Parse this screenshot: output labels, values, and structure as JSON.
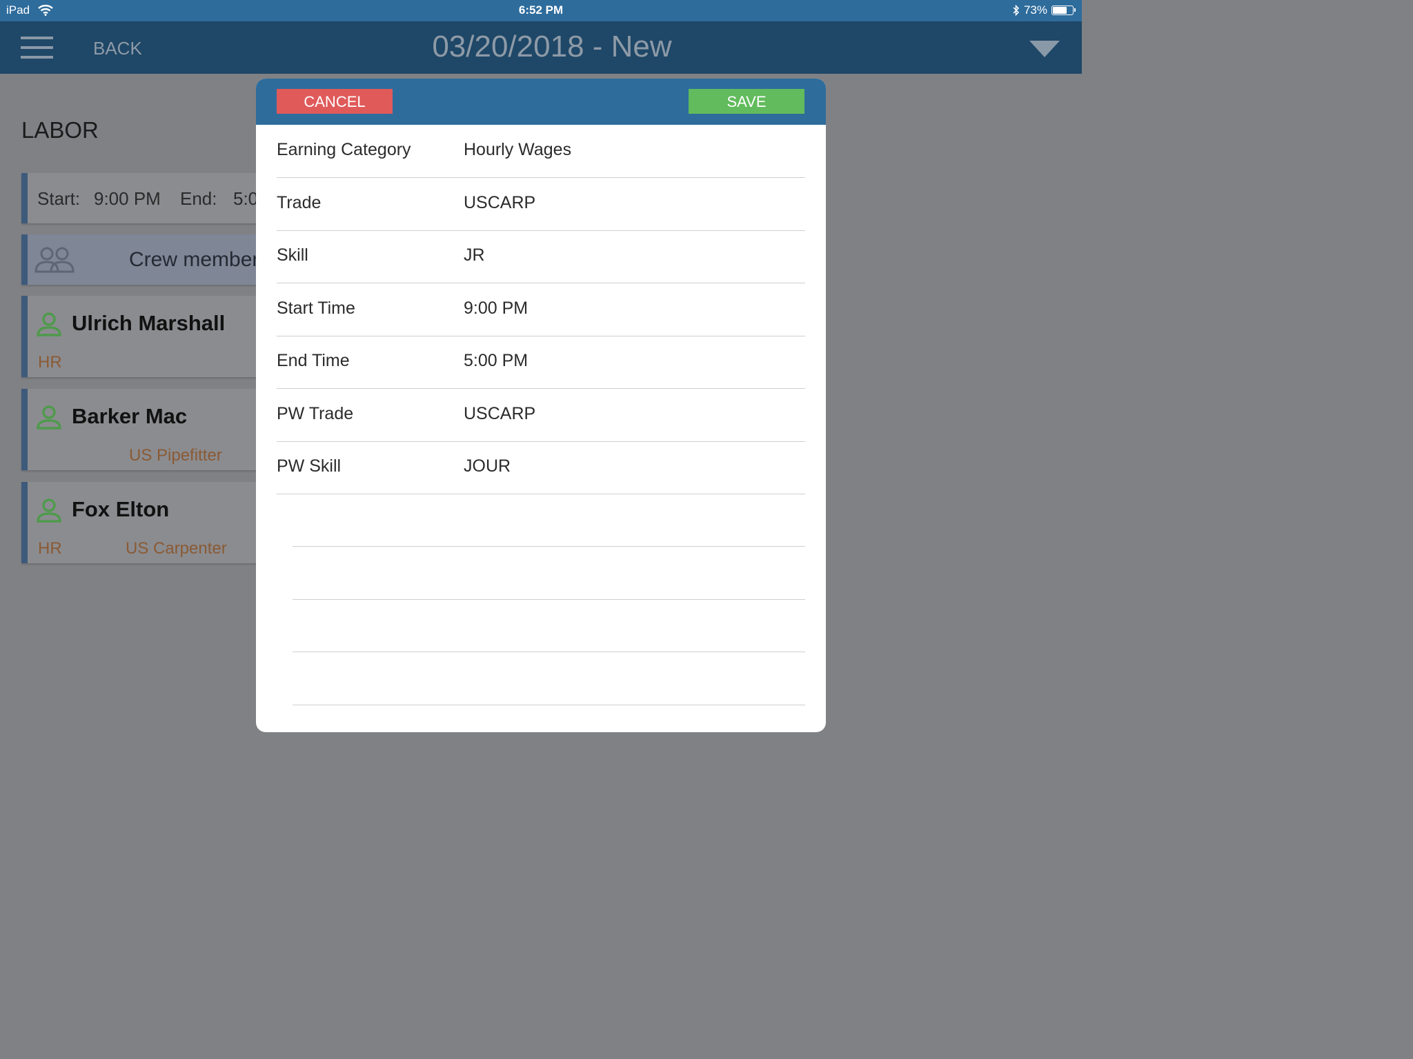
{
  "status_bar": {
    "carrier": "iPad",
    "time": "6:52 PM",
    "battery_percent": "73%",
    "battery_level": 0.73
  },
  "header": {
    "back_label": "BACK",
    "title": "03/20/2018 - New"
  },
  "labor": {
    "title": "LABOR",
    "time_card": {
      "start_label": "Start:",
      "start_value": "9:00 PM",
      "end_label": "End:",
      "end_value": "5:0"
    },
    "crew_label": "Crew member",
    "members": [
      {
        "name": "Ulrich Marshall",
        "sub1": "HR",
        "sub2": ""
      },
      {
        "name": "Barker Mac",
        "sub1": "",
        "sub2": "US Pipefitter"
      },
      {
        "name": "Fox Elton",
        "sub1": "HR",
        "sub2": "US Carpenter"
      }
    ]
  },
  "modal": {
    "cancel_label": "CANCEL",
    "save_label": "SAVE",
    "fields": [
      {
        "label": "Earning Category",
        "value": "Hourly Wages"
      },
      {
        "label": "Trade",
        "value": "USCARP"
      },
      {
        "label": "Skill",
        "value": "JR"
      },
      {
        "label": "Start Time",
        "value": "9:00 PM"
      },
      {
        "label": "End Time",
        "value": "5:00 PM"
      },
      {
        "label": "PW Trade",
        "value": "USCARP"
      },
      {
        "label": "PW Skill",
        "value": "JOUR"
      }
    ]
  },
  "colors": {
    "status_bar": "#2e6c9c",
    "header": "#1f4767",
    "overlay": "#808185",
    "cancel": "#e05a5a",
    "save": "#62bb5c",
    "person_icon": "#4f9a4c",
    "subtext": "#8a5a34"
  }
}
